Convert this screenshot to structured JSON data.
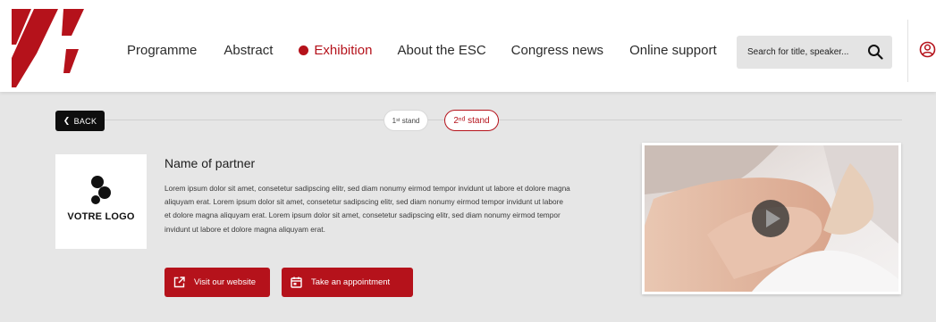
{
  "nav": {
    "items": [
      {
        "label": "Programme",
        "active": false
      },
      {
        "label": "Abstract",
        "active": false
      },
      {
        "label": "Exhibition",
        "active": true
      },
      {
        "label": "About the ESC",
        "active": false
      },
      {
        "label": "Congress news",
        "active": false
      },
      {
        "label": "Online support",
        "active": false
      }
    ]
  },
  "search": {
    "placeholder": "Search for title, speaker...",
    "icon": "search-icon"
  },
  "user": {
    "icon": "user-icon"
  },
  "subbar": {
    "back_label": "BACK",
    "stands": [
      {
        "label": "1ˢᵗ stand",
        "active": false
      },
      {
        "label": "2ⁿᵈ stand",
        "active": true
      }
    ]
  },
  "partner": {
    "logo_text": "VOTRE LOGO",
    "name": "Name of partner",
    "description": "Lorem ipsum dolor sit amet, consetetur sadipscing elitr, sed diam nonumy eirmod tempor invidunt ut labore et dolore magna aliquyam erat. Lorem ipsum dolor sit amet, consetetur sadipscing elitr, sed diam nonumy eirmod tempor invidunt ut labore et dolore magna aliquyam erat. Lorem ipsum dolor sit amet, consetetur sadipscing elitr, sed diam nonumy eirmod tempor invidunt ut labore et dolore magna aliquyam erat.",
    "visit_label": "Visit our website",
    "appointment_label": "Take an appointment"
  },
  "video": {
    "icon": "play-icon"
  },
  "colors": {
    "brand": "#b5121b",
    "background": "#e6e6e6",
    "header": "#ffffff",
    "search_bg": "#e4e4e4"
  }
}
